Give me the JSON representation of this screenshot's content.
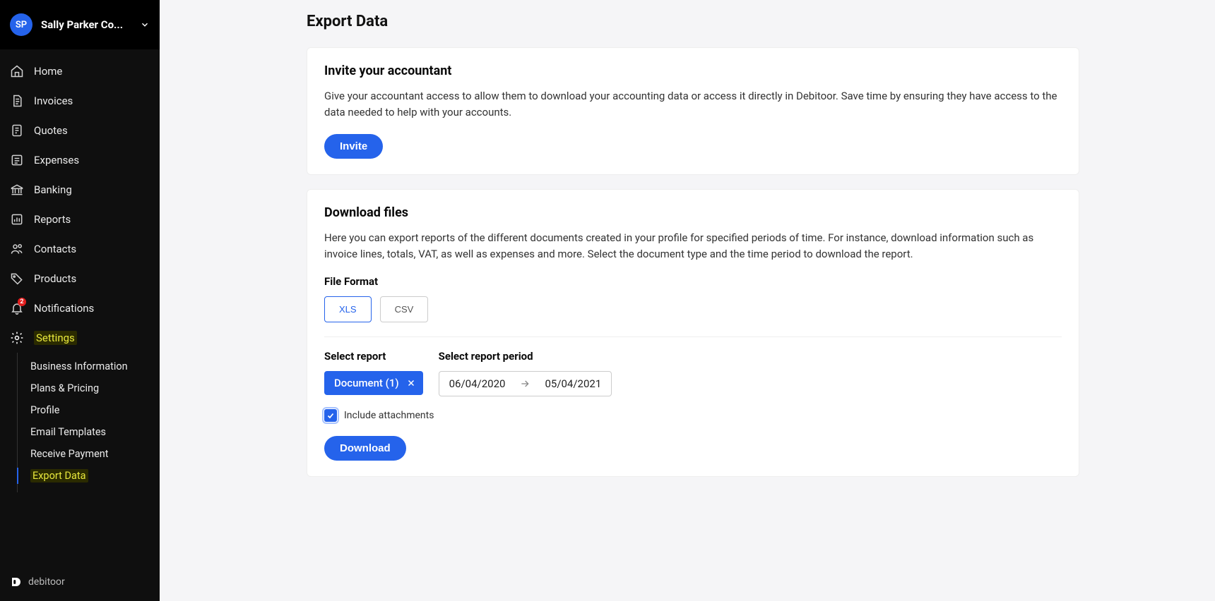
{
  "header": {
    "avatar_initials": "SP",
    "company_name": "Sally Parker Co..."
  },
  "nav": {
    "home": "Home",
    "invoices": "Invoices",
    "quotes": "Quotes",
    "expenses": "Expenses",
    "banking": "Banking",
    "reports": "Reports",
    "contacts": "Contacts",
    "products": "Products",
    "notifications": "Notifications",
    "notifications_badge": "2",
    "settings": "Settings"
  },
  "subnav": {
    "business_info": "Business Information",
    "plans_pricing": "Plans & Pricing",
    "profile": "Profile",
    "email_templates": "Email Templates",
    "receive_payment": "Receive Payment",
    "export_data": "Export Data"
  },
  "footer": {
    "brand": "debitoor"
  },
  "page": {
    "title": "Export Data",
    "invite": {
      "heading": "Invite your accountant",
      "desc": "Give your accountant access to allow them to download your accounting data or access it directly in Debitoor. Save time by ensuring they have access to the data needed to help with your accounts.",
      "button": "Invite"
    },
    "download": {
      "heading": "Download files",
      "desc": "Here you can export reports of the different documents created in your profile for specified periods of time. For instance, download information such as invoice lines, totals, VAT, as well as expenses and more. Select the document type and the time period to download the report.",
      "file_format_label": "File Format",
      "format_xls": "XLS",
      "format_csv": "CSV",
      "select_report_label": "Select report",
      "select_period_label": "Select report period",
      "report_chip": "Document (1)",
      "date_from": "06/04/2020",
      "date_to": "05/04/2021",
      "include_attachments": "Include attachments",
      "download_button": "Download"
    }
  }
}
